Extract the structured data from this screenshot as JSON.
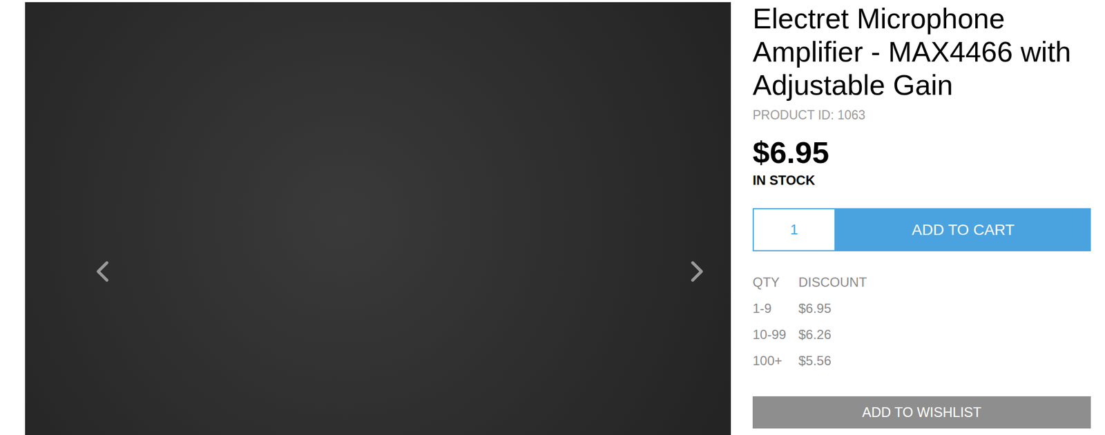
{
  "product": {
    "title": "Electret Microphone Amplifier - MAX4466 with Adjustable Gain",
    "product_id": "PRODUCT ID: 1063",
    "price": "$6.95",
    "stock": "IN STOCK"
  },
  "cart": {
    "quantity": "1",
    "button": "ADD TO CART"
  },
  "discounts": {
    "columns": [
      "QTY",
      "DISCOUNT"
    ],
    "rows": [
      {
        "qty": "1-9",
        "price": "$6.95"
      },
      {
        "qty": "10-99",
        "price": "$6.26"
      },
      {
        "qty": "100+",
        "price": "$5.56"
      }
    ]
  },
  "wishlist": {
    "button": "ADD TO WISHLIST"
  }
}
